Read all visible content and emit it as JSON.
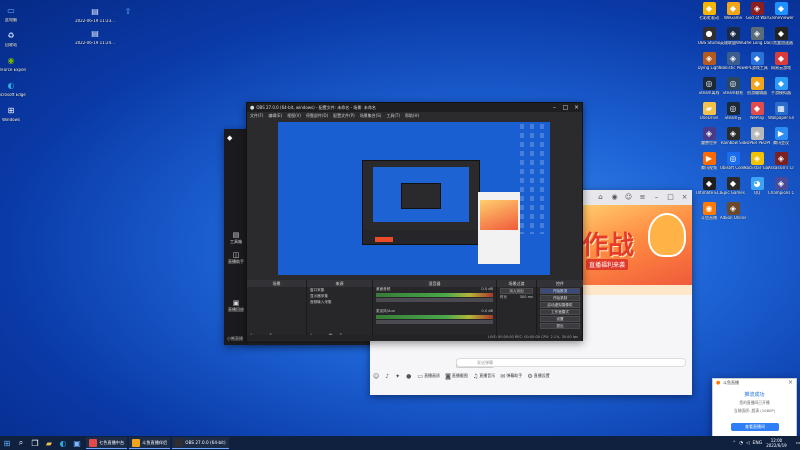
{
  "desktop": {
    "left_icons": [
      {
        "label": "此电脑",
        "icon": "computer-icon",
        "color": "#6cb6ff"
      },
      {
        "label": "回收站",
        "icon": "recycle-bin-icon",
        "color": "#c8dcff"
      },
      {
        "label": "GeForce Experience",
        "icon": "nvidia-icon",
        "color": "#76b900"
      },
      {
        "label": "Microsoft Edge",
        "icon": "edge-icon",
        "color": "#2ea7e0"
      },
      {
        "label": "Windows",
        "icon": "windows-icon",
        "color": "#ffffff"
      }
    ],
    "left_files": [
      {
        "label": "2022-06-19 11:23...",
        "icon": "file-icon"
      },
      {
        "label": "2022-06-19 11:24...",
        "icon": "file-icon"
      }
    ],
    "right_icons": [
      {
        "label": "七彩虹驱动",
        "icon": "app-icon",
        "color": "#f5b400"
      },
      {
        "label": "WeGame",
        "icon": "wegame-icon",
        "color": "#f2a51a"
      },
      {
        "label": "God of War",
        "icon": "game-icon",
        "color": "#8b1e1e"
      },
      {
        "label": "GameViewer",
        "icon": "app-icon",
        "color": "#1e90ff"
      },
      {
        "label": "OBS Studio",
        "icon": "obs-icon",
        "color": "#302e31"
      },
      {
        "label": "英雄联盟WeGame版",
        "icon": "lol-icon",
        "color": "#1a2b4a"
      },
      {
        "label": "The Long Dark",
        "icon": "game-icon",
        "color": "#5a6b7a"
      },
      {
        "label": "小黑盒加速器",
        "icon": "app-icon",
        "color": "#222222"
      },
      {
        "label": "Dying Light",
        "icon": "game-icon",
        "color": "#b55a1e"
      },
      {
        "label": "Ballistic Power...",
        "icon": "game-icon",
        "color": "#3b5e8f"
      },
      {
        "label": "IPL游戏工具",
        "icon": "app-icon",
        "color": "#2a73d8"
      },
      {
        "label": "网易云游戏",
        "icon": "app-icon",
        "color": "#d93a3a"
      },
      {
        "label": "Steam离线",
        "icon": "steam-icon",
        "color": "#1b2838"
      },
      {
        "label": "Steam联机",
        "icon": "steam-icon",
        "color": "#2a475e"
      },
      {
        "label": "创游编辑器",
        "icon": "app-icon",
        "color": "#f2a51a"
      },
      {
        "label": "手游模拟器",
        "icon": "app-icon",
        "color": "#2b9bf4"
      },
      {
        "label": "OneDrive",
        "icon": "folder-icon",
        "color": "#f3c24a"
      },
      {
        "label": "Steam云",
        "icon": "steam-icon",
        "color": "#1b2838"
      },
      {
        "label": "WePlay",
        "icon": "app-icon",
        "color": "#e24b4b"
      },
      {
        "label": "Wallpaper Engine",
        "icon": "wallpaper-icon",
        "color": "#2a6cc9"
      },
      {
        "label": "魔兽世界",
        "icon": "game-icon",
        "color": "#4a3b8a"
      },
      {
        "label": "Rainbow Six",
        "icon": "game-icon",
        "color": "#2b2b2b"
      },
      {
        "label": "SUPER PEOPLE",
        "icon": "game-icon",
        "color": "#b8b8b8"
      },
      {
        "label": "腾讯会议",
        "icon": "meeting-icon",
        "color": "#2b8cf4"
      },
      {
        "label": "腾讯视频",
        "icon": "video-icon",
        "color": "#ff6a00"
      },
      {
        "label": "Ubisoft Connect",
        "icon": "ubisoft-icon",
        "color": "#1a6df0"
      },
      {
        "label": "Rockstar Games",
        "icon": "game-icon",
        "color": "#f2c200"
      },
      {
        "label": "Assassin's Creed",
        "icon": "game-icon",
        "color": "#7a2222"
      },
      {
        "label": "Ultimate ECUS",
        "icon": "app-icon",
        "color": "#1e1e1e"
      },
      {
        "label": "Epic Games",
        "icon": "epic-icon",
        "color": "#2a2a2a"
      },
      {
        "label": "QQ",
        "icon": "qq-icon",
        "color": "#3da3f5"
      },
      {
        "label": "Champions Online",
        "icon": "game-icon",
        "color": "#4a4a9a"
      },
      {
        "label": "斗鱼直播",
        "icon": "live-icon",
        "color": "#ff7a00"
      },
      {
        "label": "Albion Online",
        "icon": "game-icon",
        "color": "#6a4a2a"
      }
    ]
  },
  "obs": {
    "title": "OBS 27.0.0 (64-bit, windows) - 配置文件: 未命名 - 场景: 未命名",
    "menu": [
      "文件(F)",
      "编辑(E)",
      "视图(V)",
      "停靠部件(D)",
      "配置文件(P)",
      "场景集合(S)",
      "工具(T)",
      "帮助(H)"
    ],
    "docks": {
      "scenes": {
        "title": "场景"
      },
      "sources": {
        "title": "来源",
        "items": [
          "窗口采集",
          "显示器采集",
          "音频输入采集"
        ]
      },
      "mixer": {
        "title": "混音器",
        "channels": [
          {
            "name": "桌面音频",
            "db": "0.0 dB"
          },
          {
            "name": "麦克风/Aux",
            "db": "0.0 dB"
          }
        ]
      },
      "transitions": {
        "title": "场景过渡",
        "type": "淡入淡出",
        "duration_label": "时长",
        "duration": "300 ms"
      },
      "controls": {
        "title": "控件",
        "buttons": [
          "开始推流",
          "开始录制",
          "启动虚拟摄像机",
          "工作室模式",
          "设置",
          "退出"
        ]
      }
    },
    "status": "LIVE: 00:00:00  REC: 00:00:00  CPU: 2.1%, 30.00 fps"
  },
  "dark_client": {
    "rail_items": [
      {
        "label": "工具箱",
        "icon": "toolbox-icon"
      },
      {
        "label": "直播助手",
        "icon": "assistant-icon"
      },
      {
        "label": "直播回放",
        "icon": "replay-icon"
      }
    ],
    "footer": "小熊直播"
  },
  "live_app": {
    "promo_big": "作战",
    "promo_sub": "直播福利来袭",
    "join_chip": "公屏气泡上线啦",
    "input_placeholder": "发送弹幕",
    "bottom_bar": [
      {
        "label": "",
        "icon": "smile-icon"
      },
      {
        "label": "",
        "icon": "mic-icon"
      },
      {
        "label": "",
        "icon": "gift-icon"
      },
      {
        "label": "",
        "icon": "record-icon"
      },
      {
        "label": "直播画质",
        "icon": "screen-icon"
      },
      {
        "label": "直播截图",
        "icon": "camera-icon"
      },
      {
        "label": "直播音乐",
        "icon": "music-icon"
      },
      {
        "label": "弹幕助手",
        "icon": "chat-icon"
      },
      {
        "label": "直播设置",
        "icon": "settings-icon"
      }
    ]
  },
  "notification": {
    "app": "斗鱼直播",
    "title": "推流成功",
    "line1": "您的直播间已开播",
    "line2": "当前画质: 超清 (1080P)",
    "button": "查看直播间"
  },
  "taskbar": {
    "apps": [
      {
        "label": "七色直播中台",
        "color": "#e24b4b"
      },
      {
        "label": "斗鱼直播伴侣",
        "color": "#f2a51a"
      },
      {
        "label": "OBS 27.0.0 (64-bit)",
        "color": "#302e31"
      }
    ],
    "tray": {
      "lang": "ENG",
      "time": "12:00",
      "date": "2022/6/19"
    }
  }
}
